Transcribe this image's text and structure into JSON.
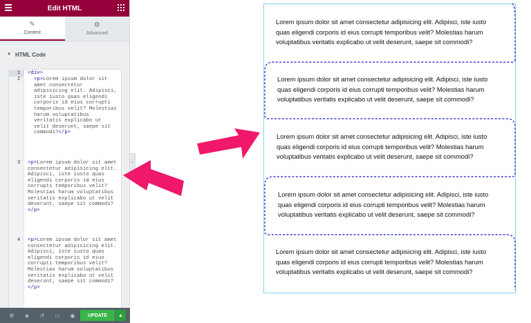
{
  "editor": {
    "title": "Edit HTML",
    "tabs": [
      {
        "label": "Content",
        "icon": "pencil-icon"
      },
      {
        "label": "Advanced",
        "icon": "gear-icon"
      }
    ],
    "section": "HTML Code",
    "code_lines": [
      {
        "n": "1",
        "open": "<div>",
        "text": "",
        "close": ""
      },
      {
        "n": "2",
        "open": "<p>",
        "text": "Lorem ipsum dolor sit amet consectetur adipisicing elit. Adipisci, iste iusto quas eligendi corporis id eius corrupti temporibus velit? Molestias harum voluptatibus veritatis explicabo ut velit deserunt, saepe sit commodi?",
        "close": "</p>"
      },
      {
        "n": "3",
        "open": "<p>",
        "text": "Lorem ipsum dolor sit amet consectetur adipisicing elit. Adipisci, iste iusto quas eligendi corporis id eius corrupti temporibus velit? Molestias harum voluptatibus veritatis explicabo ut velit deserunt, saepe sit commodi?",
        "close": "</p>"
      },
      {
        "n": "4",
        "open": "<p>",
        "text": "Lorem ipsum dolor sit amet consectetur adipisicing elit. Adipisci, iste iusto quas eligendi corporis id eius corrupti temporibus velit? Molestias harum voluptatibus veritatis explicabo ut velit deserunt, saepe sit commodi?",
        "close": "</p>"
      }
    ],
    "footer": {
      "icons": [
        "settings-icon",
        "layers-icon",
        "history-icon",
        "responsive-icon",
        "preview-eye-icon"
      ],
      "update_label": "UPDATE"
    }
  },
  "preview": {
    "paragraphs": [
      {
        "line1": "Lorem ipsum dolor sit amet consectetur adipisicing elit. Adipisci, iste iusto",
        "line2": "quas eligendi corporis id eius corrupti temporibus velit? Molestias harum",
        "line3": "voluptatibus veritatis explicabo ut velit deserunt, saepe sit commodi?"
      },
      {
        "line1": "Lorem ipsum dolor sit amet consectetur adipisicing elit. Adipisci, iste iusto",
        "line2": "quas eligendi corporis id eius corrupti temporibus velit? Molestias harum",
        "line3": "voluptatibus veritatis explicabo ut velit deserunt, saepe sit commodi?"
      },
      {
        "line1": "Lorem ipsum dolor sit amet consectetur adipisicing elit. Adipisci, iste iusto",
        "line2": "quas eligendi corporis id eius corrupti temporibus velit? Molestias harum",
        "line3": "voluptatibus veritatis explicabo ut velit deserunt, saepe sit commodi?"
      },
      {
        "line1": "Lorem ipsum dolor sit amet consectetur adipisicing elit. Adipisci, iste iusto",
        "line2": "quas eligendi corporis id eius corrupti temporibus velit? Molestias harum",
        "line3": "voluptatibus veritatis explicabo ut velit deserunt, saepe sit commodi?"
      },
      {
        "line1": "Lorem ipsum dolor sit amet consectetur adipisicing elit. Adipisci, iste iusto",
        "line2": "quas eligendi corporis id eius corrupti temporibus velit? Molestias harum",
        "line3": "voluptatibus veritatis explicabo ut velit deserunt, saepe sit commodi?"
      }
    ]
  },
  "colors": {
    "brand": "#93003a",
    "arrow": "#f0186b",
    "dash": "#3a3ad0",
    "frame": "#86d0e6",
    "update": "#39b54a"
  }
}
